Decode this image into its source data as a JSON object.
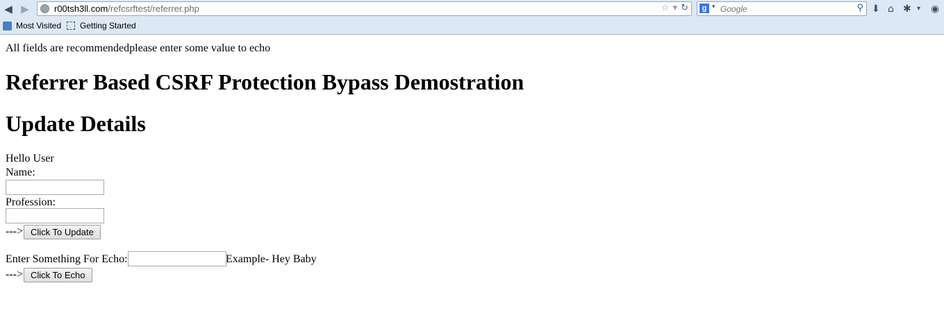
{
  "browser": {
    "url_host": "r00tsh3ll.com",
    "url_path": "/refcsrftest/referrer.php",
    "search_placeholder": "Google",
    "bookmarks": [
      "Most Visited",
      "Getting Started"
    ]
  },
  "page": {
    "notice": "All fields are recommendedplease enter some value to echo",
    "title": "Referrer Based CSRF Protection Bypass Demostration",
    "section_title": "Update Details",
    "greeting": "Hello User",
    "name_label": "Name:",
    "profession_label": "Profession:",
    "arrow_prefix": "--->",
    "update_button": "Click To Update",
    "echo_label": "Enter Something For Echo:",
    "echo_example": "Example- Hey Baby",
    "echo_arrow": "--->",
    "echo_button": "Click To Echo"
  }
}
